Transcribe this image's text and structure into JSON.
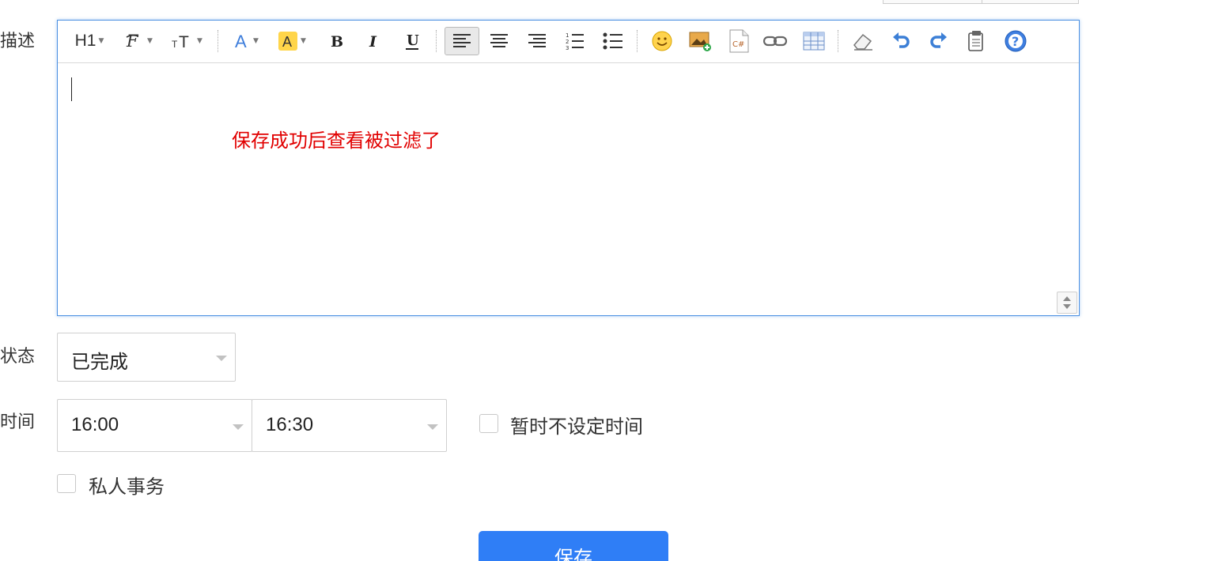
{
  "form": {
    "description_label": "描述",
    "status_label": "状态",
    "time_label": "时间"
  },
  "editor": {
    "content_text": "保存成功后查看被过滤了",
    "content_color": "#e10000",
    "toolbar": {
      "heading_label": "H1",
      "icons": [
        "heading-icon",
        "font-family-icon",
        "font-size-icon",
        "font-color-icon",
        "highlight-color-icon",
        "bold-icon",
        "italic-icon",
        "underline-icon",
        "align-left-icon",
        "align-center-icon",
        "align-right-icon",
        "ordered-list-icon",
        "unordered-list-icon",
        "emoji-icon",
        "insert-image-icon",
        "code-block-icon",
        "link-icon",
        "table-icon",
        "eraser-icon",
        "undo-icon",
        "redo-icon",
        "paste-icon",
        "help-icon"
      ]
    }
  },
  "status": {
    "selected": "已完成"
  },
  "time": {
    "start": "16:00",
    "end": "16:30",
    "no_time_label": "暂时不设定时间",
    "no_time_checked": false
  },
  "private": {
    "label": "私人事务",
    "checked": false
  },
  "actions": {
    "save_label": "保存"
  },
  "colors": {
    "accent": "#2f7ef6",
    "editor_border": "#4a90e2"
  }
}
